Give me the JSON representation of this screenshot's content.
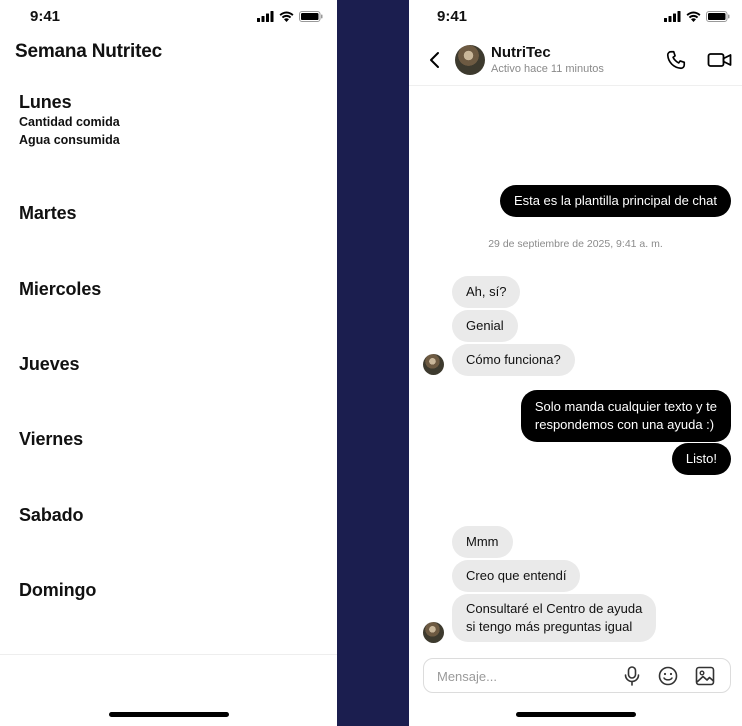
{
  "left_screen": {
    "status_time": "9:41",
    "title": "Semana Nutritec",
    "days": [
      {
        "name": "Lunes",
        "details": [
          "Cantidad comida",
          "Agua consumida"
        ]
      },
      {
        "name": "Martes"
      },
      {
        "name": "Miercoles"
      },
      {
        "name": "Jueves"
      },
      {
        "name": "Viernes"
      },
      {
        "name": "Sabado"
      },
      {
        "name": "Domingo"
      }
    ]
  },
  "right_screen": {
    "status_time": "9:41",
    "header": {
      "name": "NutriTec",
      "status": "Activo hace 11 minutos"
    },
    "timestamp": "29 de septiembre de 2025, 9:41 a. m.",
    "messages": [
      {
        "from": "me",
        "lines": [
          "Esta es la plantilla principal de chat"
        ]
      },
      {
        "from": "them",
        "lines": [
          "Ah, sí?"
        ]
      },
      {
        "from": "them",
        "lines": [
          "Genial"
        ]
      },
      {
        "from": "them",
        "lines": [
          "Cómo funciona?"
        ]
      },
      {
        "from": "me",
        "lines": [
          "Solo manda cualquier texto y te",
          "respondemos con una ayuda :)"
        ]
      },
      {
        "from": "me",
        "lines": [
          "Listo!"
        ]
      },
      {
        "from": "them",
        "lines": [
          "Mmm"
        ]
      },
      {
        "from": "them",
        "lines": [
          "Creo que entendí"
        ]
      },
      {
        "from": "them",
        "lines": [
          "Consultaré el Centro de ayuda",
          "si tengo más preguntas igual"
        ]
      }
    ],
    "composer": {
      "placeholder": "Mensaje..."
    }
  },
  "icons": [
    "signal-icon",
    "wifi-icon",
    "battery-icon",
    "back-icon",
    "phone-icon",
    "video-icon",
    "microphone-icon",
    "emoji-icon",
    "image-icon"
  ],
  "colors": {
    "background": "#1b1e4f",
    "outgoing_bubble": "#000000",
    "incoming_bubble": "#eaeaea",
    "muted_text": "#8a8a8a"
  }
}
